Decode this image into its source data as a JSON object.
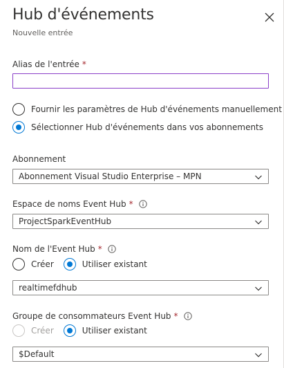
{
  "panel": {
    "title": "Hub d'événements",
    "subtitle": "Nouvelle entrée",
    "close_icon": "close-icon"
  },
  "alias": {
    "label": "Alias de l'entrée",
    "required_mark": "*",
    "value": "",
    "placeholder": ""
  },
  "source_mode": {
    "options": [
      {
        "label": "Fournir les paramètres de Hub d'événements manuellement",
        "selected": false
      },
      {
        "label": "Sélectionner Hub d'événements dans vos abonnements",
        "selected": true
      }
    ]
  },
  "subscription": {
    "label": "Abonnement",
    "value": "Abonnement Visual Studio Enterprise – MPN"
  },
  "namespace": {
    "label": "Espace de noms Event Hub",
    "required_mark": "*",
    "value": "ProjectSparkEventHub"
  },
  "event_hub_name": {
    "label": "Nom de l'Event Hub",
    "required_mark": "*",
    "create_label": "Créer",
    "existing_label": "Utiliser existant",
    "selected": "existing",
    "value": "realtimefdhub"
  },
  "consumer_group": {
    "label": "Groupe de consommateurs Event Hub",
    "required_mark": "*",
    "create_label": "Créer",
    "create_disabled": true,
    "existing_label": "Utiliser existant",
    "selected": "existing",
    "value": "$Default"
  },
  "colors": {
    "accent": "#0078d4",
    "required": "#a4262c",
    "focus_border": "#8a3ec8",
    "border": "#8a8886",
    "text": "#323130",
    "muted": "#605e5c"
  }
}
